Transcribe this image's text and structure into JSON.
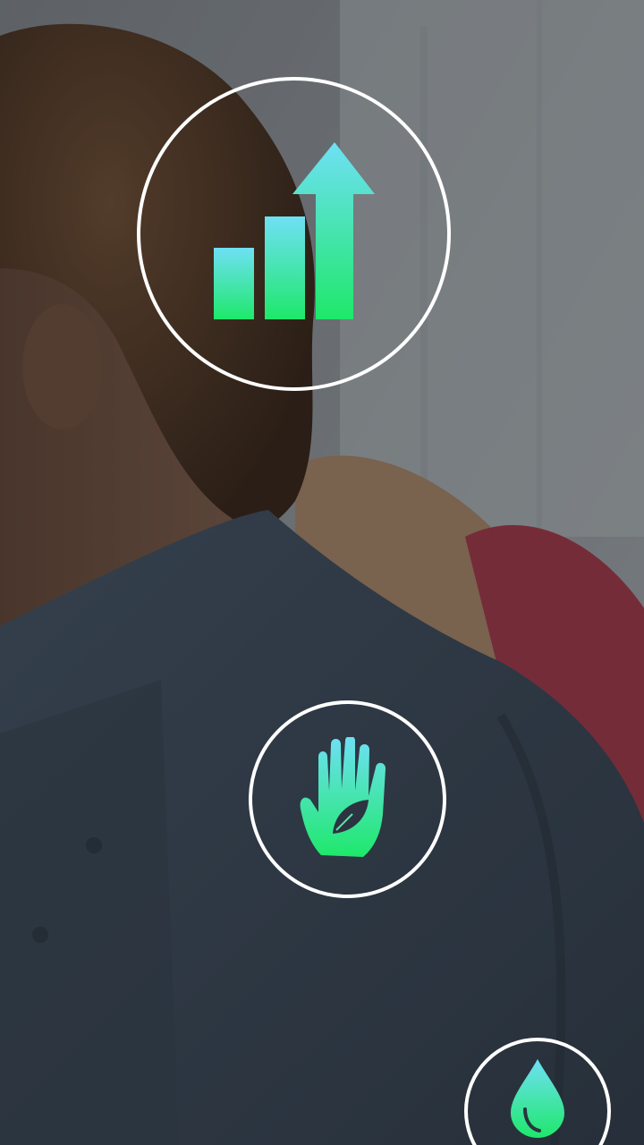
{
  "screen": {
    "name": "onboarding-features",
    "background": "photo-man-with-curly-hair-blue-shirt"
  },
  "colors": {
    "overlay": "#121418",
    "circle_border": "#ffffff",
    "icon_gradient_top": "#6fe0f5",
    "icon_gradient_bottom": "#1ee86a"
  },
  "features": [
    {
      "icon": "bar-chart-growth-icon"
    },
    {
      "icon": "hand-leaf-icon"
    },
    {
      "icon": "water-drop-icon"
    }
  ]
}
